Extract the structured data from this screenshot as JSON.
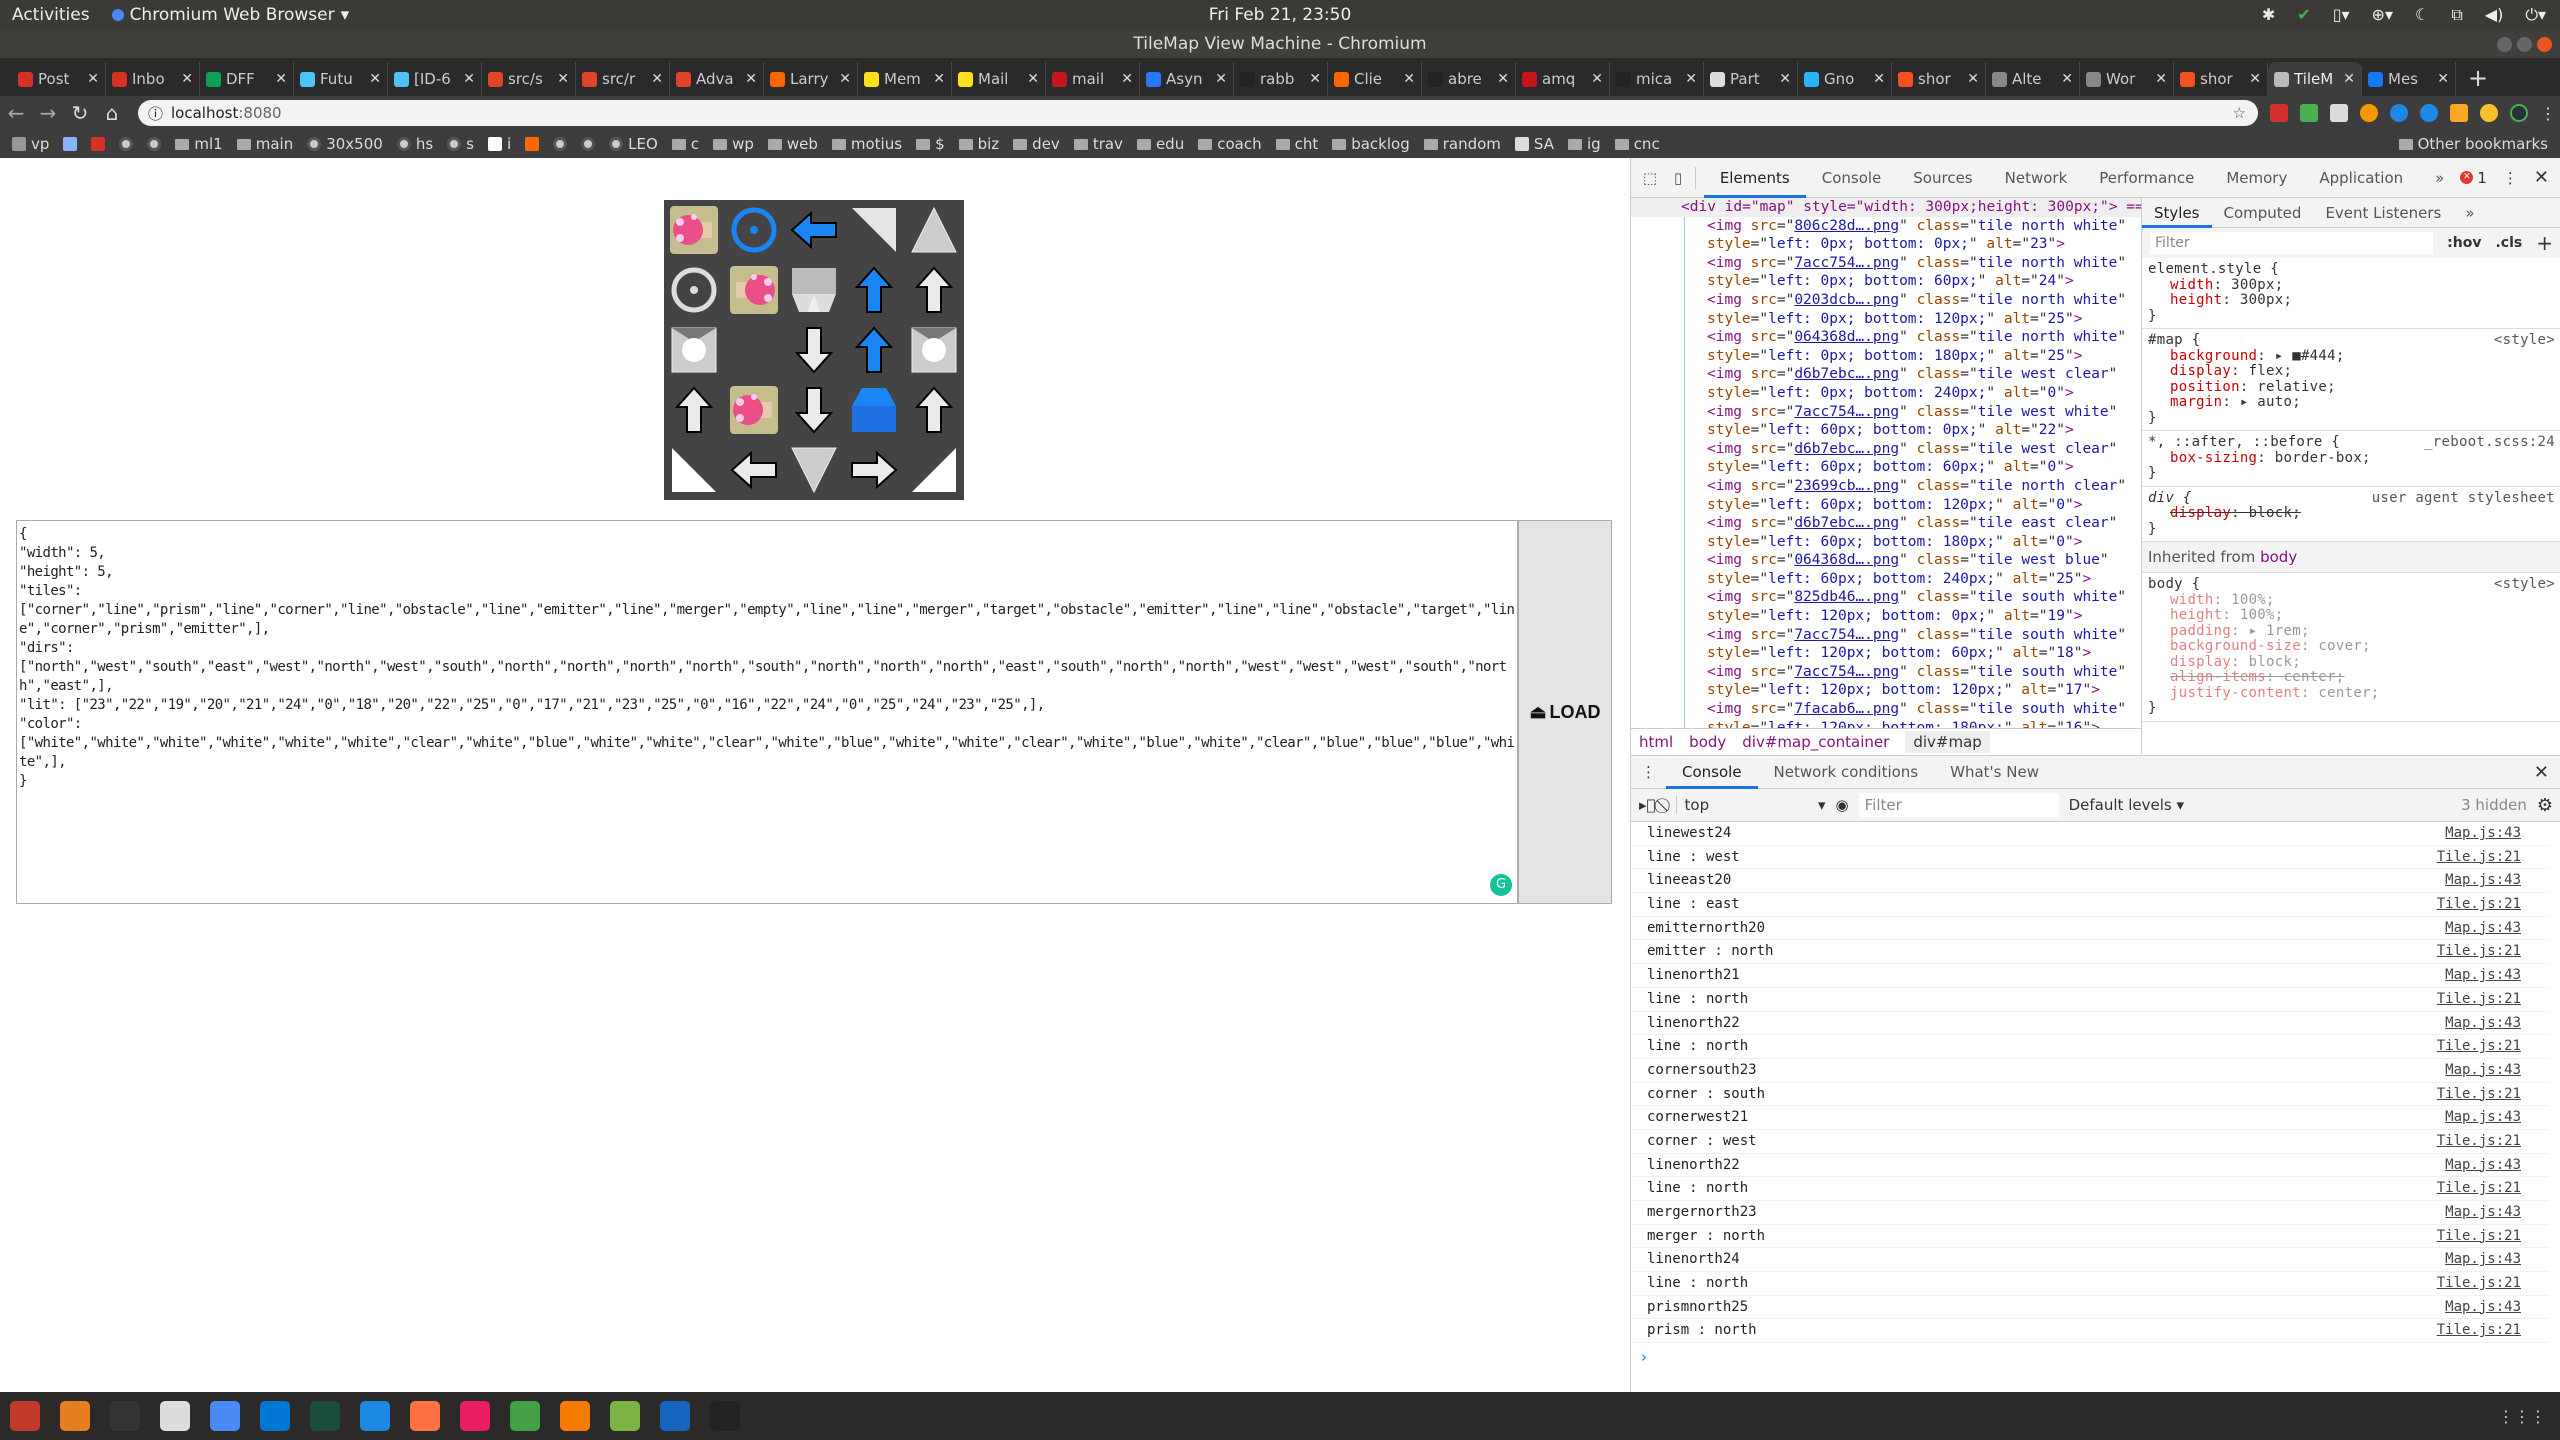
{
  "system": {
    "activities": "Activities",
    "app_name": "Chromium Web Browser",
    "clock": "Fri Feb 21, 23:50"
  },
  "window": {
    "title": "TileMap View Machine - Chromium"
  },
  "tabs": [
    {
      "label": "Post",
      "color": "#d93025"
    },
    {
      "label": "Inbo",
      "color": "#d93025"
    },
    {
      "label": "DFF",
      "color": "#0f9d58"
    },
    {
      "label": "Futu",
      "color": "#4fc3f7"
    },
    {
      "label": "[ID-6",
      "color": "#4fc3f7"
    },
    {
      "label": "src/s",
      "color": "#e24329"
    },
    {
      "label": "src/r",
      "color": "#e24329"
    },
    {
      "label": "Adva",
      "color": "#e24329"
    },
    {
      "label": "Larry",
      "color": "#ff6600"
    },
    {
      "label": "Mem",
      "color": "#ffe01b"
    },
    {
      "label": "Mail",
      "color": "#ffe01b"
    },
    {
      "label": "mail",
      "color": "#c4161c"
    },
    {
      "label": "Asyn",
      "color": "#2979ff"
    },
    {
      "label": "rabb",
      "color": "#222"
    },
    {
      "label": "Clie",
      "color": "#ff6600"
    },
    {
      "label": "abre",
      "color": "#222"
    },
    {
      "label": "amq",
      "color": "#c4161c"
    },
    {
      "label": "mica",
      "color": "#222"
    },
    {
      "label": "Part",
      "color": "#ddd"
    },
    {
      "label": "Gno",
      "color": "#29b6f6"
    },
    {
      "label": "shor",
      "color": "#f4511e"
    },
    {
      "label": "Alte",
      "color": "#888"
    },
    {
      "label": "Wor",
      "color": "#888"
    },
    {
      "label": "shor",
      "color": "#f4511e"
    },
    {
      "label": "TileM",
      "color": "#bbb",
      "active": true
    },
    {
      "label": "Mes",
      "color": "#1877f2"
    }
  ],
  "toolbar": {
    "url_host": "localhost",
    "url_port": ":8080"
  },
  "bookmarks": [
    {
      "label": "vp",
      "icon": "doc"
    },
    {
      "label": "",
      "icon": "calendar"
    },
    {
      "label": "",
      "icon": "gmail"
    },
    {
      "label": "",
      "icon": "globe"
    },
    {
      "label": "",
      "icon": "globe"
    },
    {
      "label": "ml1",
      "icon": "folder"
    },
    {
      "label": "main",
      "icon": "folder"
    },
    {
      "label": "30x500",
      "icon": "globe"
    },
    {
      "label": "hs",
      "icon": "globe"
    },
    {
      "label": "s",
      "icon": "globe"
    },
    {
      "label": "i",
      "icon": "ih"
    },
    {
      "label": "",
      "icon": "y"
    },
    {
      "label": "",
      "icon": "globe"
    },
    {
      "label": "",
      "icon": "globe"
    },
    {
      "label": "LEO",
      "icon": "globe"
    },
    {
      "label": "c",
      "icon": "folder"
    },
    {
      "label": "wp",
      "icon": "folder"
    },
    {
      "label": "web",
      "icon": "folder"
    },
    {
      "label": "motius",
      "icon": "folder"
    },
    {
      "label": "$",
      "icon": "folder"
    },
    {
      "label": "biz",
      "icon": "folder"
    },
    {
      "label": "dev",
      "icon": "folder"
    },
    {
      "label": "trav",
      "icon": "folder"
    },
    {
      "label": "edu",
      "icon": "folder"
    },
    {
      "label": "coach",
      "icon": "folder"
    },
    {
      "label": "cht",
      "icon": "folder"
    },
    {
      "label": "backlog",
      "icon": "folder"
    },
    {
      "label": "random",
      "icon": "folder"
    },
    {
      "label": "SA",
      "icon": "pen"
    },
    {
      "label": "ig",
      "icon": "folder"
    },
    {
      "label": "cnc",
      "icon": "folder"
    }
  ],
  "other_bookmarks": "Other bookmarks",
  "map": {
    "background": "#444",
    "rows": [
      [
        {
          "type": "target",
          "dir": "east"
        },
        {
          "type": "emitter",
          "color": "blue"
        },
        {
          "type": "line",
          "dir": "west",
          "color": "blue"
        },
        {
          "type": "corner",
          "dir": "ne",
          "color": "white"
        },
        {
          "type": "prism",
          "dir": "north"
        }
      ],
      [
        {
          "type": "emitter",
          "color": "white"
        },
        {
          "type": "target",
          "dir": "west"
        },
        {
          "type": "merger",
          "dir": "south",
          "color": "white"
        },
        {
          "type": "line",
          "dir": "north",
          "color": "blue"
        },
        {
          "type": "line",
          "dir": "north",
          "color": "white"
        }
      ],
      [
        {
          "type": "obstacle"
        },
        {
          "type": "empty"
        },
        {
          "type": "line",
          "dir": "south",
          "color": "white"
        },
        {
          "type": "line",
          "dir": "north",
          "color": "blue"
        },
        {
          "type": "obstacle"
        }
      ],
      [
        {
          "type": "line",
          "dir": "north",
          "color": "white"
        },
        {
          "type": "target",
          "dir": "east"
        },
        {
          "type": "line",
          "dir": "south",
          "color": "white"
        },
        {
          "type": "merger",
          "dir": "north",
          "color": "blue"
        },
        {
          "type": "line",
          "dir": "north",
          "color": "white"
        }
      ],
      [
        {
          "type": "corner",
          "dir": "sw",
          "color": "white"
        },
        {
          "type": "line",
          "dir": "west",
          "color": "white"
        },
        {
          "type": "prism",
          "dir": "south"
        },
        {
          "type": "line",
          "dir": "east",
          "color": "white"
        },
        {
          "type": "corner",
          "dir": "se",
          "color": "white"
        }
      ]
    ]
  },
  "editor": {
    "text": "{\n\"width\": 5,\n\"height\": 5,\n\"tiles\":\n[\"corner\",\"line\",\"prism\",\"line\",\"corner\",\"line\",\"obstacle\",\"line\",\"emitter\",\"line\",\"merger\",\"empty\",\"line\",\"line\",\"merger\",\"target\",\"obstacle\",\"emitter\",\"line\",\"line\",\"obstacle\",\"target\",\"line\",\"corner\",\"prism\",\"emitter\",],\n\"dirs\":\n[\"north\",\"west\",\"south\",\"east\",\"west\",\"north\",\"west\",\"south\",\"north\",\"north\",\"north\",\"north\",\"south\",\"north\",\"north\",\"north\",\"east\",\"south\",\"north\",\"north\",\"west\",\"west\",\"west\",\"south\",\"north\",\"east\",],\n\"lit\": [\"23\",\"22\",\"19\",\"20\",\"21\",\"24\",\"0\",\"18\",\"20\",\"22\",\"25\",\"0\",\"17\",\"21\",\"23\",\"25\",\"0\",\"16\",\"22\",\"24\",\"0\",\"25\",\"24\",\"23\",\"25\",],\n\"color\":\n[\"white\",\"white\",\"white\",\"white\",\"white\",\"white\",\"clear\",\"white\",\"blue\",\"white\",\"white\",\"clear\",\"white\",\"blue\",\"white\",\"white\",\"clear\",\"white\",\"blue\",\"white\",\"clear\",\"blue\",\"blue\",\"blue\",\"white\",],\n}",
    "load_label": "LOAD"
  },
  "devtools": {
    "tabs": [
      "Elements",
      "Console",
      "Sources",
      "Network",
      "Performance",
      "Memory",
      "Application"
    ],
    "error_count": "1",
    "elements_top": "<div id=\"map\" style=\"width: 300px;height: 300px;\"> == $0",
    "elements": [
      {
        "src": "806c28d….png",
        "class": "tile north white",
        "style": "left: 0px; bottom: 0px;",
        "alt": "23"
      },
      {
        "src": "7acc754….png",
        "class": "tile north white",
        "style": "left: 0px; bottom: 60px;",
        "alt": "24"
      },
      {
        "src": "0203dcb….png",
        "class": "tile north white",
        "style": "left: 0px; bottom: 120px;",
        "alt": "25"
      },
      {
        "src": "064368d….png",
        "class": "tile north white",
        "style": "left: 0px; bottom: 180px;",
        "alt": "25"
      },
      {
        "src": "d6b7ebc….png",
        "class": "tile west clear",
        "style": "left: 0px; bottom: 240px;",
        "alt": "0"
      },
      {
        "src": "7acc754….png",
        "class": "tile west white",
        "style": "left: 60px; bottom: 0px;",
        "alt": "22"
      },
      {
        "src": "d6b7ebc….png",
        "class": "tile west clear",
        "style": "left: 60px; bottom: 60px;",
        "alt": "0"
      },
      {
        "src": "23699cb….png",
        "class": "tile north clear",
        "style": "left: 60px; bottom: 120px;",
        "alt": "0"
      },
      {
        "src": "d6b7ebc….png",
        "class": "tile east clear",
        "style": "left: 60px; bottom: 180px;",
        "alt": "0"
      },
      {
        "src": "064368d….png",
        "class": "tile west blue",
        "style": "left: 60px; bottom: 240px;",
        "alt": "25"
      },
      {
        "src": "825db46….png",
        "class": "tile south white",
        "style": "left: 120px; bottom: 0px;",
        "alt": "19"
      },
      {
        "src": "7acc754….png",
        "class": "tile south white",
        "style": "left: 120px; bottom: 60px;",
        "alt": "18"
      },
      {
        "src": "7acc754….png",
        "class": "tile south white",
        "style": "left: 120px; bottom: 120px;",
        "alt": "17"
      },
      {
        "src": "7facab6….png",
        "class": "tile south white",
        "style": "left: 120px; bottom: 180px;",
        "alt": "16"
      }
    ],
    "breadcrumb": [
      "html",
      "body",
      "div#map_container",
      "div#map"
    ],
    "styles_tabs": [
      "Styles",
      "Computed",
      "Event Listeners"
    ],
    "styles_filter": "Filter",
    "hov": ":hov",
    "cls": ".cls",
    "rules": [
      {
        "selector": "element.style {",
        "source": "",
        "props": [
          [
            "width",
            "300px;"
          ],
          [
            "height",
            "300px;"
          ]
        ]
      },
      {
        "selector": "#map {",
        "source": "<style>",
        "props": [
          [
            "background",
            "▸ ■#444;"
          ],
          [
            "display",
            "flex;"
          ],
          [
            "position",
            "relative;"
          ],
          [
            "margin",
            "▸ auto;"
          ]
        ]
      },
      {
        "selector": "*, ::after, ::before {",
        "source": "_reboot.scss:24",
        "props": [
          [
            "box-sizing",
            "border-box;"
          ]
        ]
      },
      {
        "selector": "div {",
        "source": "user agent stylesheet",
        "props": [
          [
            "display",
            "block;"
          ]
        ],
        "struck": true
      }
    ],
    "inherited_label": "Inherited from",
    "inherited_from": "body",
    "body_rule": {
      "selector": "body {",
      "source": "<style>",
      "props": [
        [
          "width",
          "100%;"
        ],
        [
          "height",
          "100%;"
        ],
        [
          "padding",
          "▸ 1rem;"
        ],
        [
          "background-size",
          "cover;"
        ],
        [
          "display",
          "block;"
        ],
        [
          "align-items",
          "center;"
        ],
        [
          "justify-content",
          "center;"
        ]
      ]
    },
    "drawer_tabs": [
      "Console",
      "Network conditions",
      "What's New"
    ],
    "context": "top",
    "filter": "Filter",
    "levels": "Default levels ▾",
    "hidden": "3 hidden",
    "console": [
      [
        "linewest24",
        "Map.js:43"
      ],
      [
        "line : west",
        "Tile.js:21"
      ],
      [
        "lineeast20",
        "Map.js:43"
      ],
      [
        "line : east",
        "Tile.js:21"
      ],
      [
        "emitternorth20",
        "Map.js:43"
      ],
      [
        "emitter : north",
        "Tile.js:21"
      ],
      [
        "linenorth21",
        "Map.js:43"
      ],
      [
        "line : north",
        "Tile.js:21"
      ],
      [
        "linenorth22",
        "Map.js:43"
      ],
      [
        "line : north",
        "Tile.js:21"
      ],
      [
        "cornersouth23",
        "Map.js:43"
      ],
      [
        "corner : south",
        "Tile.js:21"
      ],
      [
        "cornerwest21",
        "Map.js:43"
      ],
      [
        "corner : west",
        "Tile.js:21"
      ],
      [
        "linenorth22",
        "Map.js:43"
      ],
      [
        "line : north",
        "Tile.js:21"
      ],
      [
        "mergernorth23",
        "Map.js:43"
      ],
      [
        "merger : north",
        "Tile.js:21"
      ],
      [
        "linenorth24",
        "Map.js:43"
      ],
      [
        "line : north",
        "Tile.js:21"
      ],
      [
        "prismnorth25",
        "Map.js:43"
      ],
      [
        "prism : north",
        "Tile.js:21"
      ]
    ],
    "prompt": "›"
  },
  "colors": {
    "blue": "#1a86f5",
    "white": "#ebebeb",
    "accent": "#1a73e8"
  }
}
